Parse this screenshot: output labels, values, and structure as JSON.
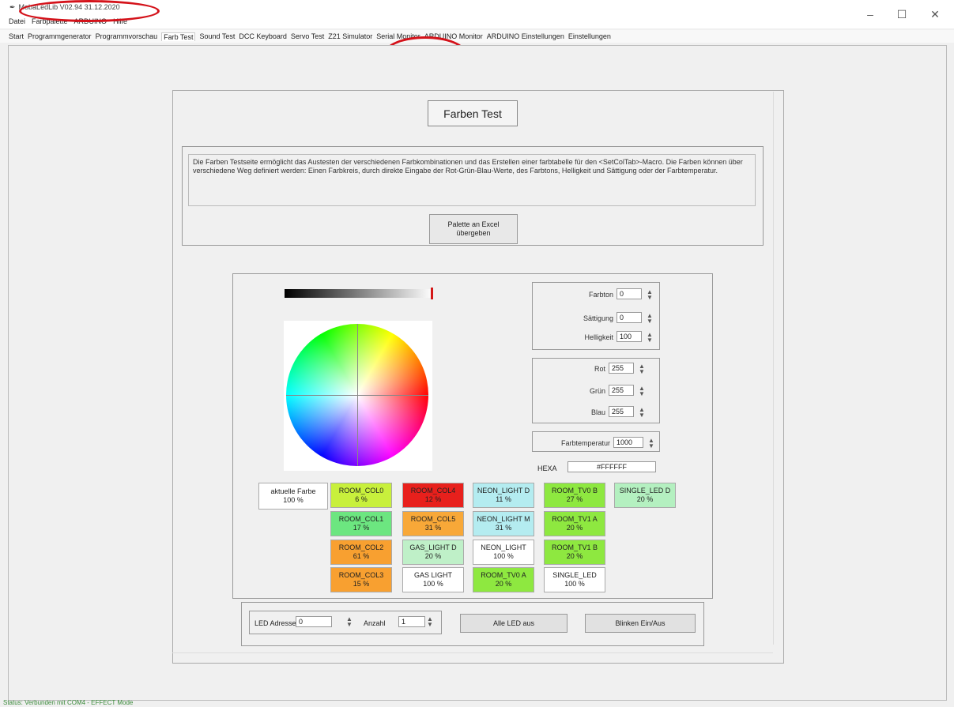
{
  "window": {
    "title": "MobaLedLib V02.94 31.12.2020",
    "min_icon": "minimize-icon",
    "max_icon": "maximize-icon",
    "close_icon": "close-icon"
  },
  "menu": [
    "Datei",
    "Farbpalette",
    "ARDUINO",
    "Hilfe"
  ],
  "tabs": [
    "Start",
    "Programmgenerator",
    "Programmvorschau",
    "Farb Test",
    "Sound Test",
    "DCC Keyboard",
    "Servo Test",
    "Z21 Simulator",
    "Serial Monitor",
    "ARDUINO Monitor",
    "ARDUINO Einstellungen",
    "Einstellungen"
  ],
  "active_tab": "Farb Test",
  "page": {
    "title": "Farben Test",
    "description": "Die Farben Testseite ermöglicht das Austesten der verschiedenen Farbkombinationen und das Erstellen einer farbtabelle für den <SetColTab>-Macro. Die Farben können über verschiedene Weg definiert werden: Einen Farbkreis, durch direkte Eingabe der Rot-Grün-Blau-Werte, des Farbtons, Helligkeit und Sättigung oder der Farbtemperatur.",
    "excel_button": [
      "Palette an Excel",
      "übergeben"
    ]
  },
  "hsv": {
    "farbton_label": "Farbton",
    "farbton": "0",
    "saettigung_label": "Sättigung",
    "saettigung": "0",
    "helligkeit_label": "Helligkeit",
    "helligkeit": "100"
  },
  "rgb": {
    "rot_label": "Rot",
    "rot": "255",
    "gruen_label": "Grün",
    "gruen": "255",
    "blau_label": "Blau",
    "blau": "255"
  },
  "temp": {
    "label": "Farbtemperatur",
    "value": "1000"
  },
  "hexa": {
    "label": "HEXA",
    "value": "#FFFFFF"
  },
  "current_color": {
    "name": "aktuelle Farbe",
    "pct": "100 %"
  },
  "swatches": [
    {
      "name": "ROOM_COL0",
      "pct": "6 %",
      "color": "#c8f03c"
    },
    {
      "name": "ROOM_COL4",
      "pct": "12 %",
      "color": "#e8201c"
    },
    {
      "name": "NEON_LIGHT D",
      "pct": "11 %",
      "color": "#b4ecf0"
    },
    {
      "name": "ROOM_TV0 B",
      "pct": "27 %",
      "color": "#8ee840"
    },
    {
      "name": "SINGLE_LED D",
      "pct": "20 %",
      "color": "#b4f0c0"
    },
    {
      "name": "ROOM_COL1",
      "pct": "17 %",
      "color": "#6ce680"
    },
    {
      "name": "ROOM_COL5",
      "pct": "31 %",
      "color": "#f8a838"
    },
    {
      "name": "NEON_LIGHT M",
      "pct": "31 %",
      "color": "#b4ecf0"
    },
    {
      "name": "ROOM_TV1 A",
      "pct": "20 %",
      "color": "#8ee840"
    },
    {
      "name": "ROOM_COL2",
      "pct": "61 %",
      "color": "#f8a030"
    },
    {
      "name": "GAS_LIGHT D",
      "pct": "20 %",
      "color": "#bff0c8"
    },
    {
      "name": "NEON_LIGHT",
      "pct": "100 %",
      "color": "#ffffff"
    },
    {
      "name": "ROOM_TV1 B",
      "pct": "20 %",
      "color": "#8ee840"
    },
    {
      "name": "ROOM_COL3",
      "pct": "15 %",
      "color": "#f8a030"
    },
    {
      "name": "GAS LIGHT",
      "pct": "100 %",
      "color": "#ffffff"
    },
    {
      "name": "ROOM_TV0 A",
      "pct": "20 %",
      "color": "#8ee840"
    },
    {
      "name": "SINGLE_LED",
      "pct": "100 %",
      "color": "#ffffff"
    }
  ],
  "controls": {
    "led_adresse_label": "LED Adresse",
    "led_adresse": "0",
    "anzahl_label": "Anzahl",
    "anzahl": "1",
    "alle_aus": "Alle LED aus",
    "blinken": "Blinken Ein/Aus"
  },
  "status": "Status: Verbunden mit COM4 - EFFECT Mode"
}
